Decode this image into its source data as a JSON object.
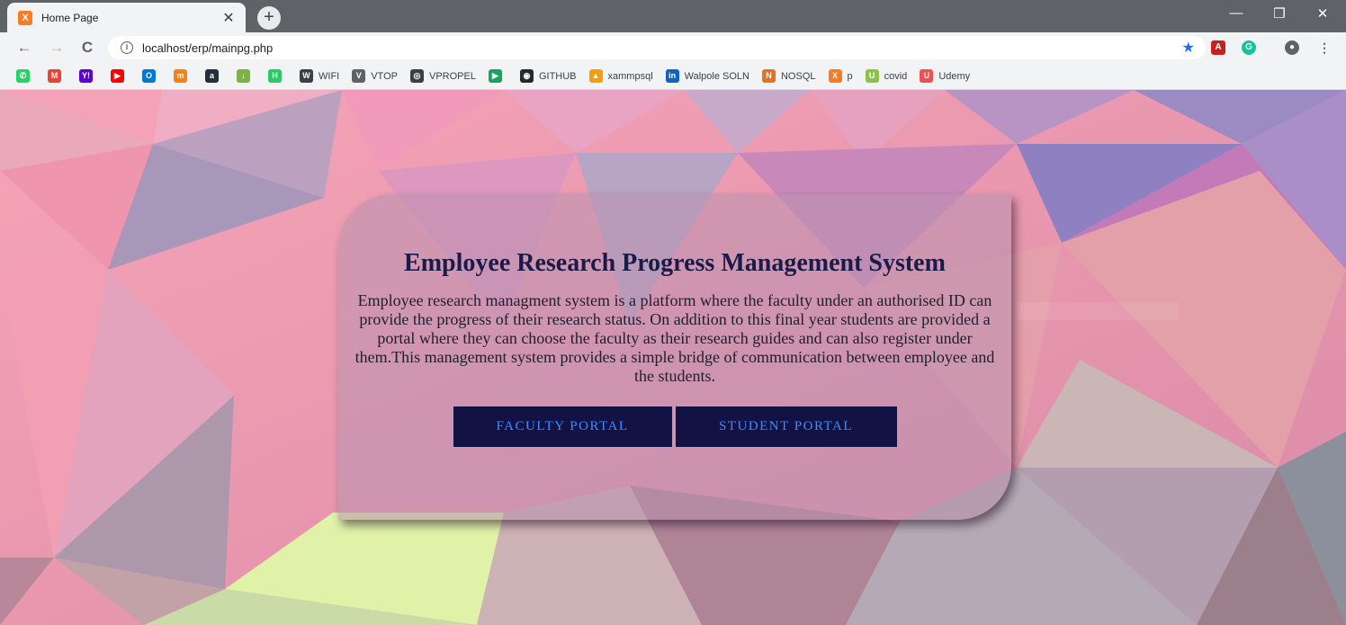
{
  "browser": {
    "tab_title": "Home Page",
    "tab_close": "✕",
    "new_tab": "+",
    "url": "localhost/erp/mainpg.php",
    "window_controls": [
      "—",
      "❐",
      "✕"
    ]
  },
  "bookmarks": [
    {
      "label": "",
      "icon": "whatsapp-icon",
      "color": "#25d366",
      "glyph": "✆"
    },
    {
      "label": "",
      "icon": "gmail-icon",
      "color": "#ea4335",
      "glyph": "M"
    },
    {
      "label": "",
      "icon": "yahoo-icon",
      "color": "#6001d2",
      "glyph": "Y!"
    },
    {
      "label": "",
      "icon": "youtube-icon",
      "color": "#ff0000",
      "glyph": "▶"
    },
    {
      "label": "",
      "icon": "outlook-icon",
      "color": "#0078d4",
      "glyph": "O"
    },
    {
      "label": "",
      "icon": "moodle-icon",
      "color": "#f98012",
      "glyph": "m"
    },
    {
      "label": "",
      "icon": "amazon-icon",
      "color": "#232f3e",
      "glyph": "a"
    },
    {
      "label": "",
      "icon": "download-icon",
      "color": "#7cb342",
      "glyph": "↓"
    },
    {
      "label": "",
      "icon": "hackerrank-icon",
      "color": "#2ec866",
      "glyph": "H"
    },
    {
      "label": "WIFI",
      "icon": "wifi-icon",
      "color": "#3c4043",
      "glyph": "W"
    },
    {
      "label": "VTOP",
      "icon": "vtop-icon",
      "color": "#5f6368",
      "glyph": "V"
    },
    {
      "label": "VPROPEL",
      "icon": "globe-icon",
      "color": "#3c4043",
      "glyph": "◎"
    },
    {
      "label": "",
      "icon": "play-icon",
      "color": "#1aa260",
      "glyph": "▶"
    },
    {
      "label": "GITHUB",
      "icon": "github-icon",
      "color": "#24292e",
      "glyph": "◉"
    },
    {
      "label": "xammpsql",
      "icon": "phpmyadmin-icon",
      "color": "#f89c0e",
      "glyph": "▲"
    },
    {
      "label": "Walpole SOLN",
      "icon": "linkedin-icon",
      "color": "#0a66c2",
      "glyph": "in"
    },
    {
      "label": "NOSQL",
      "icon": "nosql-icon",
      "color": "#e8711c",
      "glyph": "N"
    },
    {
      "label": "p",
      "icon": "xampp-icon",
      "color": "#fb7a24",
      "glyph": "X"
    },
    {
      "label": "covid",
      "icon": "covid-icon",
      "color": "#8bc34a",
      "glyph": "U"
    },
    {
      "label": "Udemy",
      "icon": "udemy-icon",
      "color": "#ec5252",
      "glyph": "U"
    }
  ],
  "main": {
    "title": "Employee Research Progress Management System",
    "description": "Employee research managment system is a platform where the faculty under an authorised ID can provide the progress of their research status. On addition to this final year students are provided a portal where they can choose the faculty as their research guides and can also register under them.This management system provides a simple bridge of communication between employee and the students.",
    "faculty_button": "FACULTY PORTAL",
    "student_button": "STUDENT PORTAL"
  },
  "colors": {
    "card_bg": "rgba(185,145,175,0.55)",
    "button_bg": "#121244",
    "button_text": "#3d8cff",
    "title_text": "#1b1b4a"
  }
}
